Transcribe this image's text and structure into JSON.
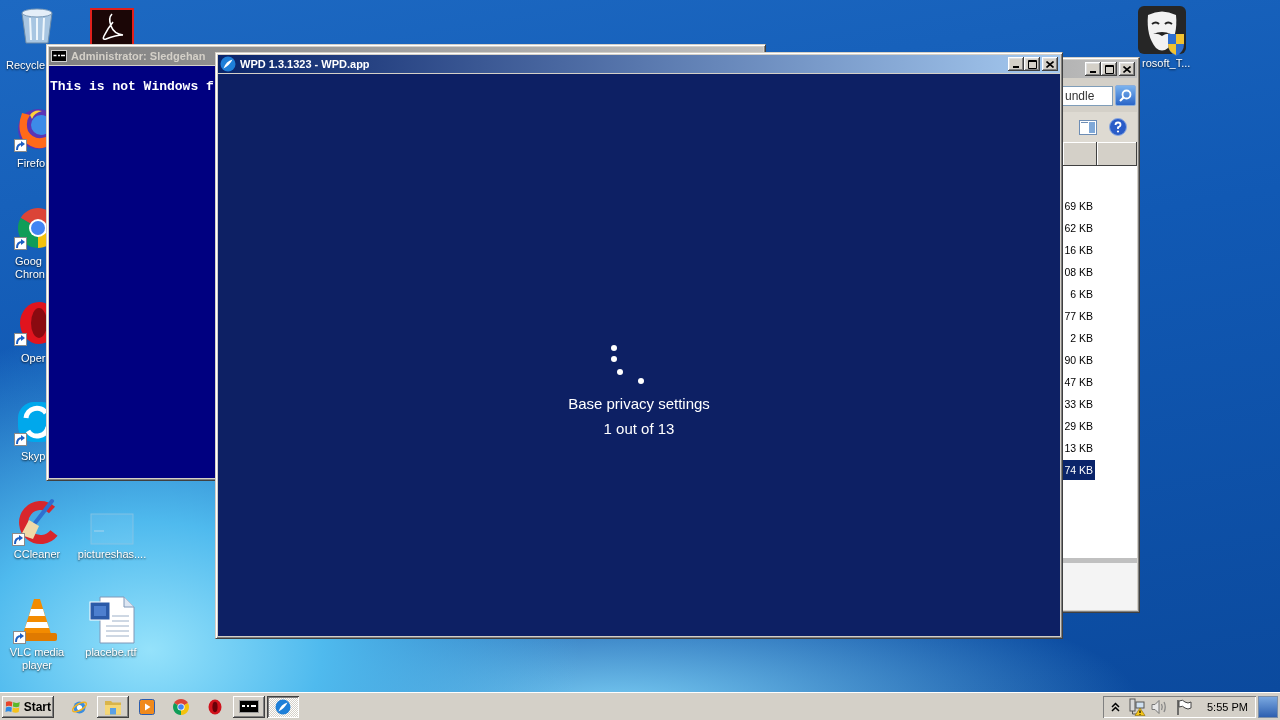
{
  "desktop_icons": [
    {
      "label": "Recycle"
    },
    {
      "label": "Firefo"
    },
    {
      "label": "Goog Chron"
    },
    {
      "label": "Oper"
    },
    {
      "label": "Skyp"
    },
    {
      "label": "CCleaner"
    },
    {
      "label": "VLC media player"
    },
    {
      "label": "pictureshas...."
    },
    {
      "label": "placebe.rtf"
    },
    {
      "label": "rosoft_T..."
    }
  ],
  "console_window": {
    "title": "Administrator: Sledgehan",
    "active": false,
    "lines": [
      "This is not Windows f"
    ]
  },
  "explorer_window": {
    "active": false,
    "search": {
      "placeholder": "undle"
    },
    "rows": [
      {
        "size": "69 KB",
        "selected": false
      },
      {
        "size": "62 KB",
        "selected": false
      },
      {
        "size": "16 KB",
        "selected": false
      },
      {
        "size": "08 KB",
        "selected": false
      },
      {
        "size": "6 KB",
        "selected": false
      },
      {
        "size": "77 KB",
        "selected": false
      },
      {
        "size": "2 KB",
        "selected": false
      },
      {
        "size": "90 KB",
        "selected": false
      },
      {
        "size": "47 KB",
        "selected": false
      },
      {
        "size": "33 KB",
        "selected": false
      },
      {
        "size": "29 KB",
        "selected": false
      },
      {
        "size": "13 KB",
        "selected": false
      },
      {
        "size": "74 KB",
        "selected": true
      }
    ]
  },
  "app_window": {
    "title": "WPD 1.3.1323 - WPD.app",
    "active": true,
    "status": "Base privacy settings",
    "step_counter": "1 out of 13"
  },
  "taskbar": {
    "start": "Start",
    "items": [
      {
        "running": false,
        "selected": false
      },
      {
        "running": true,
        "selected": false
      },
      {
        "running": false,
        "selected": false
      },
      {
        "running": false,
        "selected": false
      },
      {
        "running": false,
        "selected": false
      },
      {
        "running": true,
        "selected": false
      },
      {
        "running": true,
        "selected": true
      }
    ],
    "clock": "5:55 PM"
  }
}
